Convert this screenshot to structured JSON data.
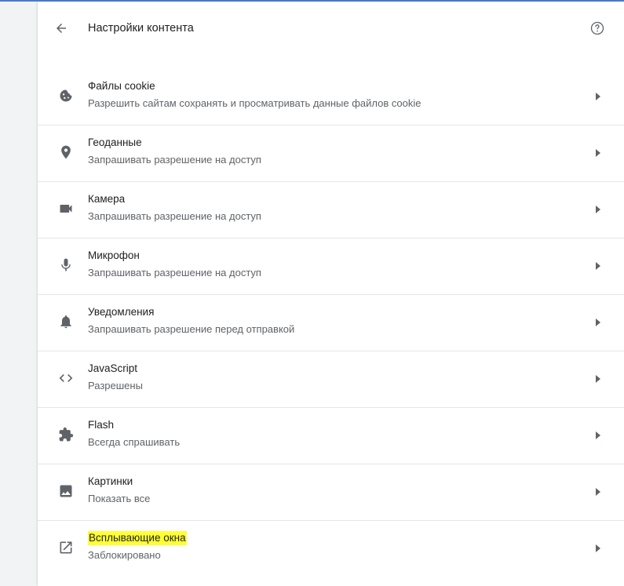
{
  "header": {
    "title": "Настройки контента",
    "back_icon": "arrow-left-icon",
    "help_icon": "help-circle-icon"
  },
  "items": [
    {
      "key": "cookies",
      "icon": "cookie-icon",
      "title": "Файлы cookie",
      "subtitle": "Разрешить сайтам сохранять и просматривать данные файлов cookie"
    },
    {
      "key": "location",
      "icon": "location-pin-icon",
      "title": "Геоданные",
      "subtitle": "Запрашивать разрешение на доступ"
    },
    {
      "key": "camera",
      "icon": "videocam-icon",
      "title": "Камера",
      "subtitle": "Запрашивать разрешение на доступ"
    },
    {
      "key": "microphone",
      "icon": "mic-icon",
      "title": "Микрофон",
      "subtitle": "Запрашивать разрешение на доступ"
    },
    {
      "key": "notifications",
      "icon": "bell-icon",
      "title": "Уведомления",
      "subtitle": "Запрашивать разрешение перед отправкой"
    },
    {
      "key": "javascript",
      "icon": "code-icon",
      "title": "JavaScript",
      "subtitle": "Разрешены"
    },
    {
      "key": "flash",
      "icon": "puzzle-icon",
      "title": "Flash",
      "subtitle": "Всегда спрашивать"
    },
    {
      "key": "images",
      "icon": "image-icon",
      "title": "Картинки",
      "subtitle": "Показать все"
    },
    {
      "key": "popups",
      "icon": "open-in-new-icon",
      "title": "Всплывающие окна",
      "subtitle": "Заблокировано",
      "highlighted": true
    }
  ],
  "colors": {
    "accent_line": "#4a7bd0",
    "highlight": "#ffff33",
    "icon": "#5f6368"
  }
}
